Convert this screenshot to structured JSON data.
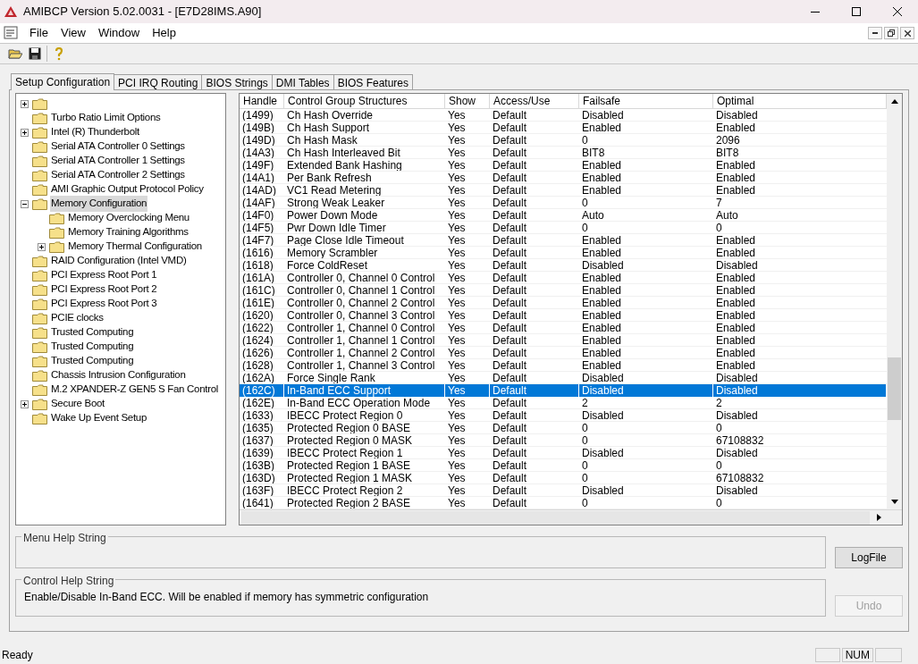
{
  "window": {
    "title": "AMIBCP Version 5.02.0031 - [E7D28IMS.A90]"
  },
  "menu": [
    "File",
    "View",
    "Window",
    "Help"
  ],
  "tabs": [
    {
      "label": "Setup Configuration",
      "selected": true
    },
    {
      "label": "PCI IRQ Routing",
      "selected": false
    },
    {
      "label": "BIOS Strings",
      "selected": false
    },
    {
      "label": "DMI Tables",
      "selected": false
    },
    {
      "label": "BIOS Features",
      "selected": false
    }
  ],
  "tree": [
    {
      "expandable": true,
      "expanded": false,
      "selected": false
    },
    {
      "label": "Turbo Ratio Limit Options",
      "expandable": false,
      "selected": false
    },
    {
      "label": "Intel (R) Thunderbolt",
      "expandable": true,
      "expanded": false,
      "selected": false
    },
    {
      "label": "Serial ATA Controller 0 Settings",
      "expandable": false,
      "selected": false
    },
    {
      "label": "Serial ATA Controller 1 Settings",
      "expandable": false,
      "selected": false
    },
    {
      "label": "Serial ATA Controller 2 Settings",
      "expandable": false,
      "selected": false
    },
    {
      "label": "AMI Graphic Output Protocol Policy",
      "expandable": false,
      "selected": false
    },
    {
      "label": "Memory Configuration",
      "expandable": true,
      "expanded": true,
      "selected": true,
      "children": [
        {
          "label": "Memory Overclocking Menu",
          "expandable": false,
          "selected": false
        },
        {
          "label": "Memory Training Algorithms",
          "expandable": false,
          "selected": false
        },
        {
          "label": "Memory Thermal Configuration",
          "expandable": true,
          "expanded": false,
          "selected": false
        }
      ]
    },
    {
      "label": "RAID Configuration (Intel VMD)",
      "expandable": false,
      "selected": false
    },
    {
      "label": "PCI Express Root Port 1",
      "expandable": false,
      "selected": false
    },
    {
      "label": "PCI Express Root Port 2",
      "expandable": false,
      "selected": false
    },
    {
      "label": "PCI Express Root Port 3",
      "expandable": false,
      "selected": false
    },
    {
      "label": "PCIE clocks",
      "expandable": false,
      "selected": false
    },
    {
      "label": "Trusted Computing",
      "expandable": false,
      "selected": false
    },
    {
      "label": "Trusted Computing",
      "expandable": false,
      "selected": false
    },
    {
      "label": "Trusted Computing",
      "expandable": false,
      "selected": false
    },
    {
      "label": "Chassis Intrusion Configuration",
      "expandable": false,
      "selected": false
    },
    {
      "label": "M.2 XPANDER-Z GEN5 S Fan Control",
      "expandable": false,
      "selected": false
    },
    {
      "label": "Secure Boot",
      "expandable": true,
      "expanded": false,
      "selected": false
    },
    {
      "label": "Wake Up Event Setup",
      "expandable": false,
      "selected": false
    }
  ],
  "table": {
    "columns": [
      "Handle",
      "Control Group Structures",
      "Show",
      "Access/Use",
      "Failsafe",
      "Optimal"
    ],
    "rows": [
      {
        "handle": "(1499)",
        "name": "Ch Hash Override",
        "show": "Yes",
        "access": "Default",
        "failsafe": "Disabled",
        "optimal": "Disabled",
        "selected": false
      },
      {
        "handle": "(149B)",
        "name": "Ch Hash Support",
        "show": "Yes",
        "access": "Default",
        "failsafe": "Enabled",
        "optimal": "Enabled",
        "selected": false
      },
      {
        "handle": "(149D)",
        "name": "Ch Hash Mask",
        "show": "Yes",
        "access": "Default",
        "failsafe": "0",
        "optimal": "2096",
        "selected": false
      },
      {
        "handle": "(14A3)",
        "name": "Ch Hash Interleaved Bit",
        "show": "Yes",
        "access": "Default",
        "failsafe": "BIT8",
        "optimal": "BIT8",
        "selected": false
      },
      {
        "handle": "(149F)",
        "name": "Extended Bank Hashing",
        "show": "Yes",
        "access": "Default",
        "failsafe": "Enabled",
        "optimal": "Enabled",
        "selected": false
      },
      {
        "handle": "(14A1)",
        "name": "Per Bank Refresh",
        "show": "Yes",
        "access": "Default",
        "failsafe": "Enabled",
        "optimal": "Enabled",
        "selected": false
      },
      {
        "handle": "(14AD)",
        "name": "VC1 Read Metering",
        "show": "Yes",
        "access": "Default",
        "failsafe": "Enabled",
        "optimal": "Enabled",
        "selected": false
      },
      {
        "handle": "(14AF)",
        "name": "Strong Weak Leaker",
        "show": "Yes",
        "access": "Default",
        "failsafe": "0",
        "optimal": "7",
        "selected": false
      },
      {
        "handle": "(14F0)",
        "name": "Power Down Mode",
        "show": "Yes",
        "access": "Default",
        "failsafe": "Auto",
        "optimal": "Auto",
        "selected": false
      },
      {
        "handle": "(14F5)",
        "name": "Pwr Down Idle Timer",
        "show": "Yes",
        "access": "Default",
        "failsafe": "0",
        "optimal": "0",
        "selected": false
      },
      {
        "handle": "(14F7)",
        "name": "Page Close Idle Timeout",
        "show": "Yes",
        "access": "Default",
        "failsafe": "Enabled",
        "optimal": "Enabled",
        "selected": false
      },
      {
        "handle": "(1616)",
        "name": "Memory Scrambler",
        "show": "Yes",
        "access": "Default",
        "failsafe": "Enabled",
        "optimal": "Enabled",
        "selected": false
      },
      {
        "handle": "(1618)",
        "name": "Force ColdReset",
        "show": "Yes",
        "access": "Default",
        "failsafe": "Disabled",
        "optimal": "Disabled",
        "selected": false
      },
      {
        "handle": "(161A)",
        "name": "Controller 0, Channel 0 Control",
        "show": "Yes",
        "access": "Default",
        "failsafe": "Enabled",
        "optimal": "Enabled",
        "selected": false
      },
      {
        "handle": "(161C)",
        "name": "Controller 0, Channel 1 Control",
        "show": "Yes",
        "access": "Default",
        "failsafe": "Enabled",
        "optimal": "Enabled",
        "selected": false
      },
      {
        "handle": "(161E)",
        "name": "Controller 0, Channel 2 Control",
        "show": "Yes",
        "access": "Default",
        "failsafe": "Enabled",
        "optimal": "Enabled",
        "selected": false
      },
      {
        "handle": "(1620)",
        "name": "Controller 0, Channel 3 Control",
        "show": "Yes",
        "access": "Default",
        "failsafe": "Enabled",
        "optimal": "Enabled",
        "selected": false
      },
      {
        "handle": "(1622)",
        "name": "Controller 1, Channel 0 Control",
        "show": "Yes",
        "access": "Default",
        "failsafe": "Enabled",
        "optimal": "Enabled",
        "selected": false
      },
      {
        "handle": "(1624)",
        "name": "Controller 1, Channel 1 Control",
        "show": "Yes",
        "access": "Default",
        "failsafe": "Enabled",
        "optimal": "Enabled",
        "selected": false
      },
      {
        "handle": "(1626)",
        "name": "Controller 1, Channel 2 Control",
        "show": "Yes",
        "access": "Default",
        "failsafe": "Enabled",
        "optimal": "Enabled",
        "selected": false
      },
      {
        "handle": "(1628)",
        "name": "Controller 1, Channel 3 Control",
        "show": "Yes",
        "access": "Default",
        "failsafe": "Enabled",
        "optimal": "Enabled",
        "selected": false
      },
      {
        "handle": "(162A)",
        "name": "Force Single Rank",
        "show": "Yes",
        "access": "Default",
        "failsafe": "Disabled",
        "optimal": "Disabled",
        "selected": false
      },
      {
        "handle": "(162C)",
        "name": "In-Band ECC Support",
        "show": "Yes",
        "access": "Default",
        "failsafe": "Disabled",
        "optimal": "Disabled",
        "selected": true
      },
      {
        "handle": "(162E)",
        "name": "In-Band ECC Operation Mode",
        "show": "Yes",
        "access": "Default",
        "failsafe": "2",
        "optimal": "2",
        "selected": false
      },
      {
        "handle": "(1633)",
        "name": "IBECC Protect Region 0",
        "show": "Yes",
        "access": "Default",
        "failsafe": "Disabled",
        "optimal": "Disabled",
        "selected": false
      },
      {
        "handle": "(1635)",
        "name": "Protected Region 0 BASE",
        "show": "Yes",
        "access": "Default",
        "failsafe": "0",
        "optimal": "0",
        "selected": false
      },
      {
        "handle": "(1637)",
        "name": "Protected Region 0 MASK",
        "show": "Yes",
        "access": "Default",
        "failsafe": "0",
        "optimal": "67108832",
        "selected": false
      },
      {
        "handle": "(1639)",
        "name": "IBECC Protect Region 1",
        "show": "Yes",
        "access": "Default",
        "failsafe": "Disabled",
        "optimal": "Disabled",
        "selected": false
      },
      {
        "handle": "(163B)",
        "name": "Protected Region 1 BASE",
        "show": "Yes",
        "access": "Default",
        "failsafe": "0",
        "optimal": "0",
        "selected": false
      },
      {
        "handle": "(163D)",
        "name": "Protected Region 1 MASK",
        "show": "Yes",
        "access": "Default",
        "failsafe": "0",
        "optimal": "67108832",
        "selected": false
      },
      {
        "handle": "(163F)",
        "name": "IBECC Protect Region 2",
        "show": "Yes",
        "access": "Default",
        "failsafe": "Disabled",
        "optimal": "Disabled",
        "selected": false
      },
      {
        "handle": "(1641)",
        "name": "Protected Region 2 BASE",
        "show": "Yes",
        "access": "Default",
        "failsafe": "0",
        "optimal": "0",
        "selected": false
      }
    ]
  },
  "menu_help": {
    "label": "Menu Help String"
  },
  "control_help": {
    "label": "Control Help String",
    "text": "Enable/Disable In-Band ECC. Will be enabled if memory has symmetric configuration"
  },
  "buttons": [
    {
      "label": "LogFile",
      "disabled": false
    },
    {
      "label": "Undo",
      "disabled": true
    }
  ],
  "status_bar": {
    "text": "Ready",
    "indicators": [
      "NUM"
    ]
  }
}
